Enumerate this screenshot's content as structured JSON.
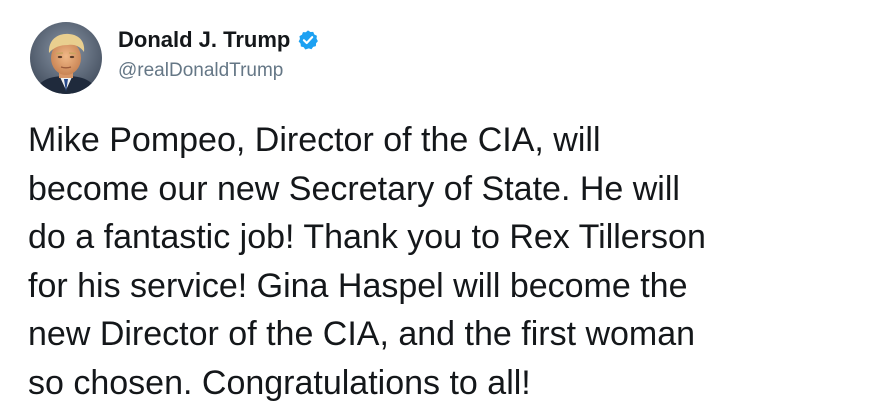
{
  "author": {
    "display_name": "Donald J. Trump",
    "handle": "@realDonaldTrump",
    "verified": true,
    "verified_icon": "verified-badge-icon",
    "verified_color": "#1da1f2",
    "avatar_icon": "profile-photo"
  },
  "tweet": {
    "lines": [
      "Mike Pompeo, Director of the CIA, will",
      "become our new Secretary of State. He will",
      "do a fantastic job! Thank you to Rex Tillerson",
      "for his service! Gina Haspel will become the",
      "new Director of the CIA, and the first woman",
      "so chosen. Congratulations to all!"
    ]
  },
  "colors": {
    "text": "#14171a",
    "secondary": "#657786",
    "accent": "#1da1f2",
    "background": "#ffffff"
  }
}
